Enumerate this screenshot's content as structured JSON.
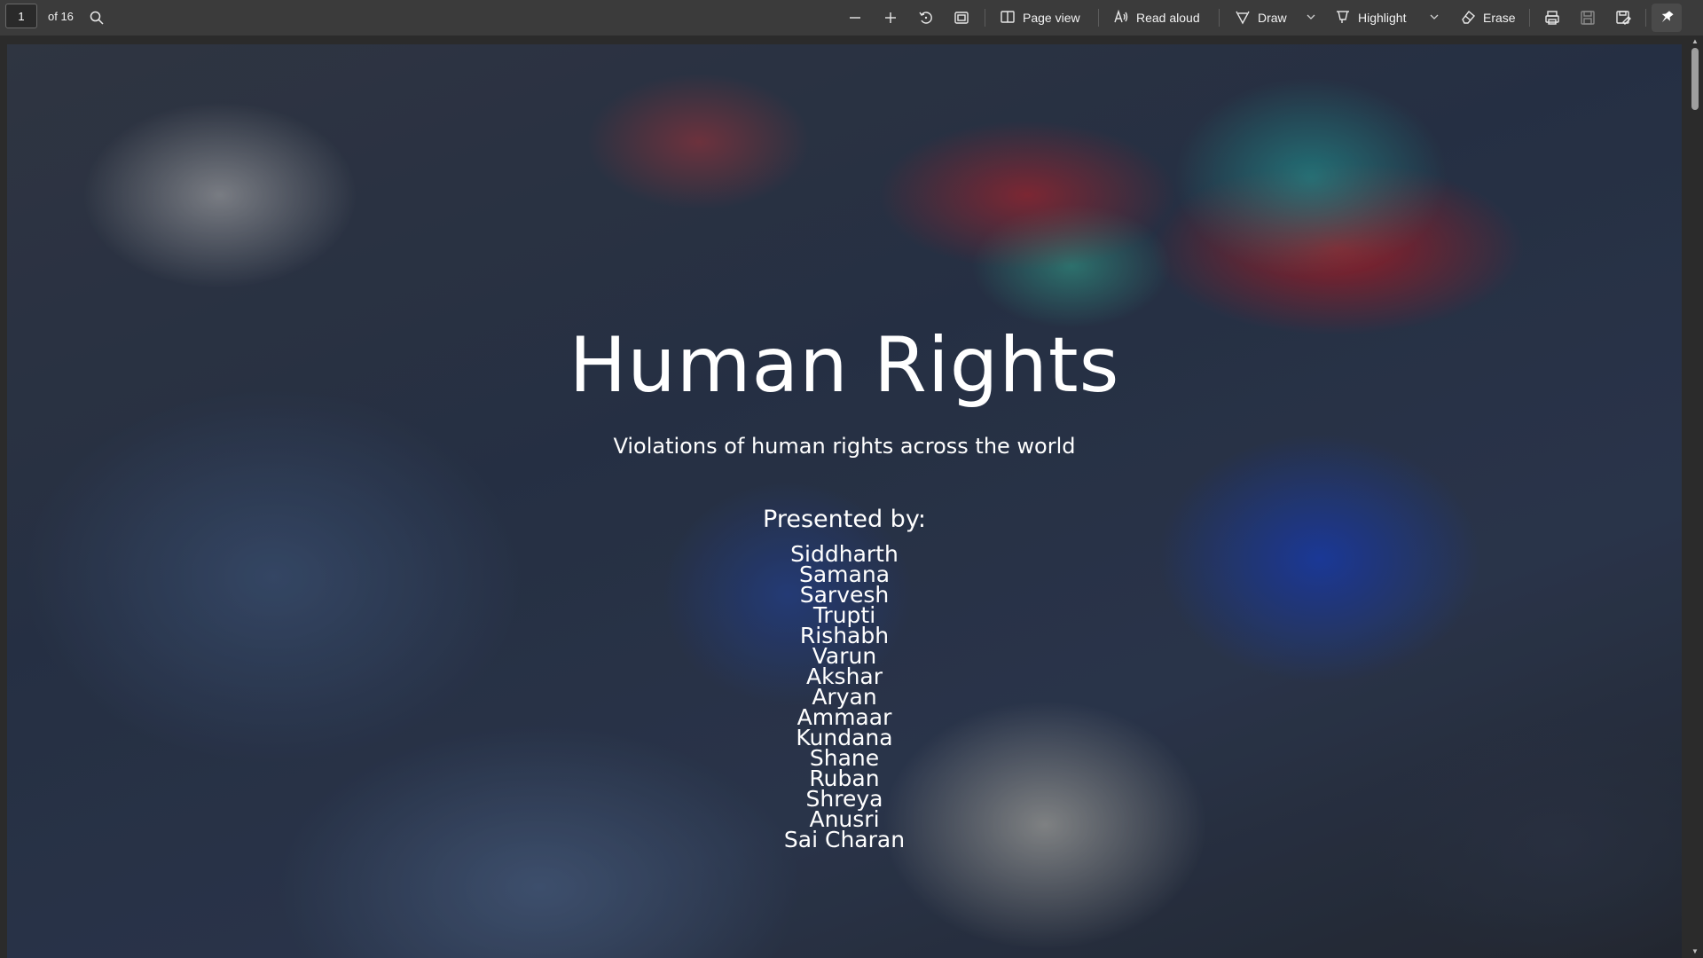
{
  "toolbar": {
    "page_number": "1",
    "page_count_label": "of 16",
    "page_view_label": "Page view",
    "read_aloud_label": "Read aloud",
    "draw_label": "Draw",
    "highlight_label": "Highlight",
    "erase_label": "Erase"
  },
  "slide": {
    "title": "Human Rights",
    "subtitle": "Violations of human rights across the world",
    "presented_by": "Presented by:",
    "names": [
      "Siddharth",
      "Samana",
      "Sarvesh",
      "Trupti",
      "Rishabh",
      "Varun",
      "Akshar",
      "Aryan",
      "Ammaar",
      "Kundana",
      "Shane",
      "Ruban",
      "Shreya",
      "Anusri",
      "Sai Charan"
    ]
  },
  "colors": {
    "toolbar_bg": "#3b3b3b",
    "viewer_bg": "#2b2b2b",
    "text": "#ffffff"
  }
}
